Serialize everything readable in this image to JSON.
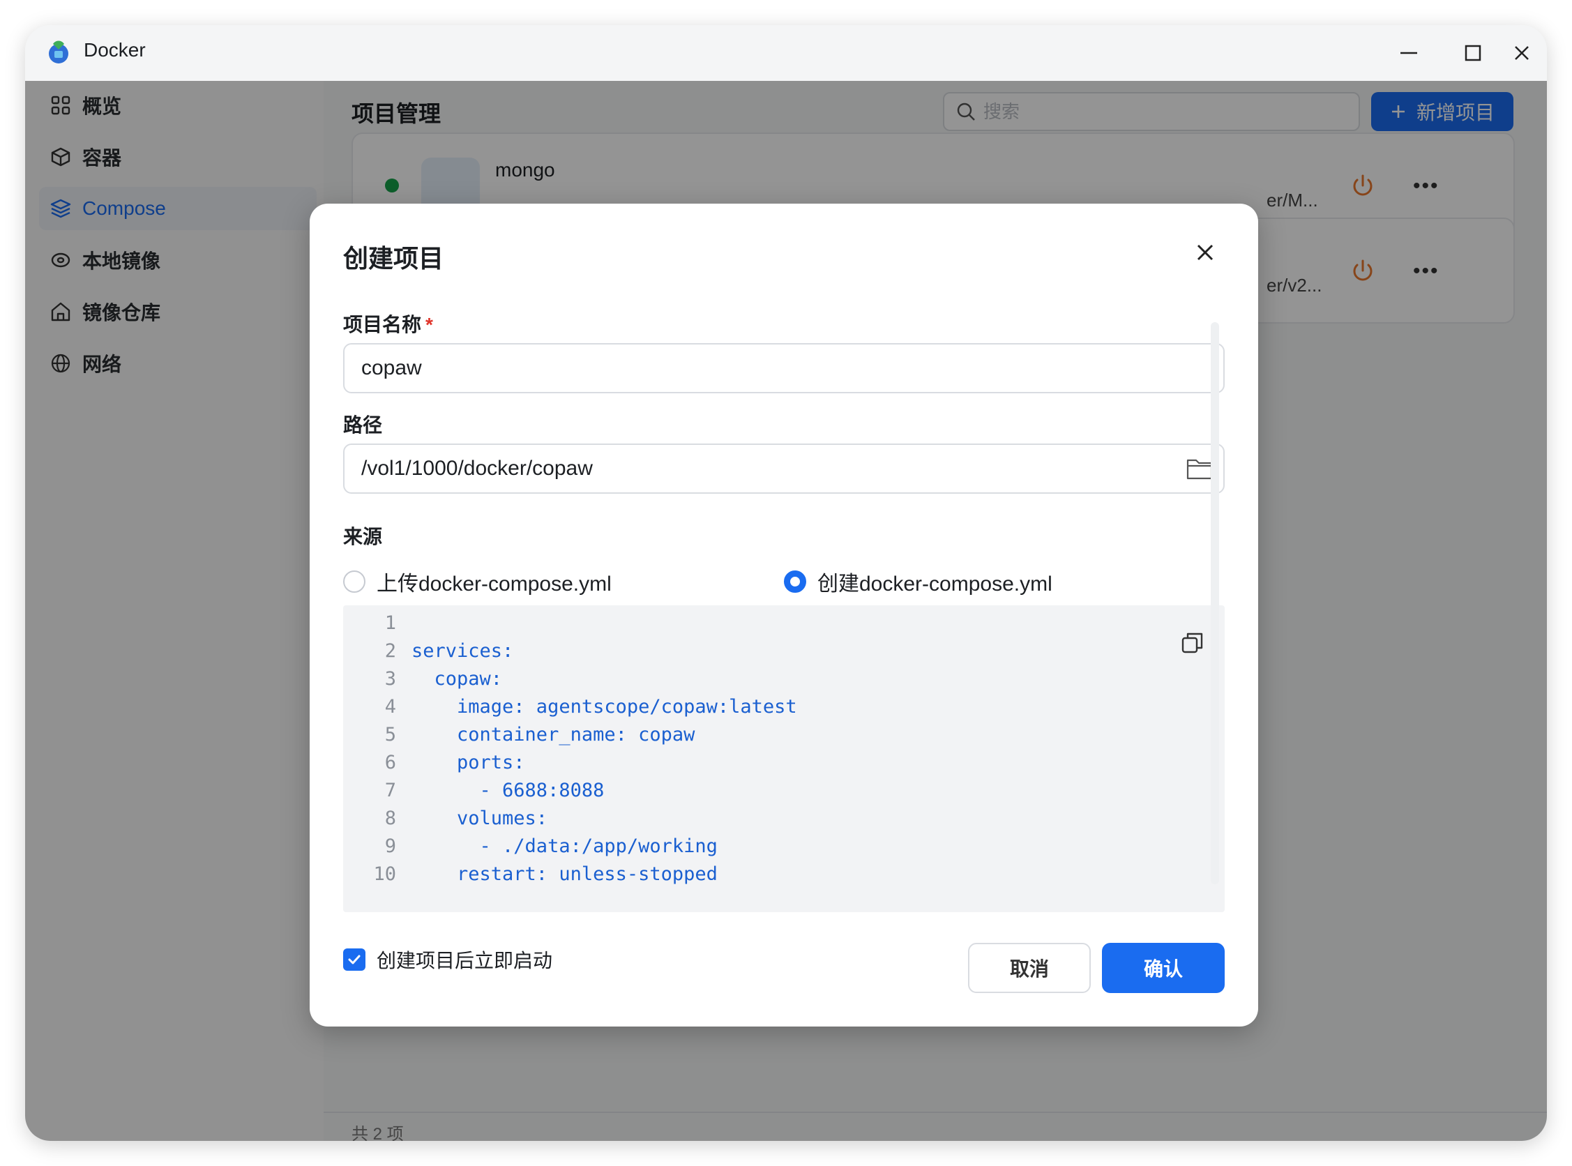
{
  "window": {
    "title": "Docker"
  },
  "sidebar": {
    "items": [
      {
        "label": "概览",
        "icon": "grid-icon"
      },
      {
        "label": "容器",
        "icon": "cube-icon"
      },
      {
        "label": "Compose",
        "icon": "layers-icon"
      },
      {
        "label": "本地镜像",
        "icon": "disk-icon"
      },
      {
        "label": "镜像仓库",
        "icon": "home-icon"
      },
      {
        "label": "网络",
        "icon": "globe-icon"
      }
    ],
    "active": "Compose"
  },
  "main": {
    "title": "项目管理",
    "search_placeholder": "搜索",
    "add_button": "新增项目",
    "projects": [
      {
        "name": "mongo",
        "path": "er/M...",
        "status": "running"
      },
      {
        "name": "",
        "path": "er/v2...",
        "status": ""
      }
    ],
    "footer": "共 2 项"
  },
  "modal": {
    "title": "创建项目",
    "name_label": "项目名称",
    "name_required": "*",
    "name_value": "copaw",
    "path_label": "路径",
    "path_value": "/vol1/1000/docker/copaw",
    "source_label": "来源",
    "source_options": [
      {
        "label": "上传docker-compose.yml",
        "checked": false
      },
      {
        "label": "创建docker-compose.yml",
        "checked": true
      }
    ],
    "code_lines": [
      "",
      "services:",
      "  copaw:",
      "    image: agentscope/copaw:latest",
      "    container_name: copaw",
      "    ports:",
      "      - 6688:8088",
      "    volumes:",
      "      - ./data:/app/working",
      "    restart: unless-stopped"
    ],
    "autostart_label": "创建项目后立即启动",
    "autostart_checked": true,
    "cancel_label": "取消",
    "confirm_label": "确认"
  },
  "colors": {
    "accent": "#1a6cf0",
    "required": "#e0352b",
    "power": "#e8772e",
    "running": "#17a34a"
  }
}
